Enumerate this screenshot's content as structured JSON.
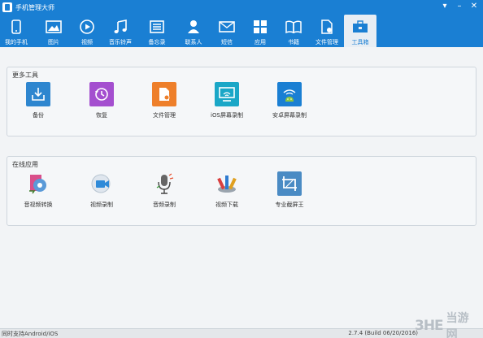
{
  "app": {
    "title": "手机管理大师"
  },
  "nav": [
    {
      "label": "我的手机",
      "icon": "phone-icon"
    },
    {
      "label": "图片",
      "icon": "image-icon"
    },
    {
      "label": "视频",
      "icon": "video-icon"
    },
    {
      "label": "音乐铃声",
      "icon": "music-icon"
    },
    {
      "label": "备忘录",
      "icon": "memo-icon"
    },
    {
      "label": "联系人",
      "icon": "contacts-icon"
    },
    {
      "label": "短信",
      "icon": "sms-icon"
    },
    {
      "label": "应用",
      "icon": "apps-icon"
    },
    {
      "label": "书籍",
      "icon": "book-icon"
    },
    {
      "label": "文件管理",
      "icon": "file-manager-icon"
    },
    {
      "label": "工具箱",
      "icon": "toolbox-icon",
      "active": true
    }
  ],
  "groups": {
    "more_tools": {
      "title": "更多工具",
      "tools": [
        {
          "label": "备份",
          "icon": "backup-icon",
          "color": "#2e86cf"
        },
        {
          "label": "恢复",
          "icon": "restore-icon",
          "color": "#a44fcf"
        },
        {
          "label": "文件管理",
          "icon": "file-manage-icon",
          "color": "#ee7f2a"
        },
        {
          "label": "iOS屏幕录制",
          "icon": "ios-screen-record-icon",
          "color": "#1aa7c7"
        },
        {
          "label": "安卓屏幕录制",
          "icon": "android-screen-record-icon",
          "color": "#1a7fd3"
        }
      ]
    },
    "online_apps": {
      "title": "在线应用",
      "tools": [
        {
          "label": "音视频转换",
          "icon": "av-convert-icon"
        },
        {
          "label": "视频录制",
          "icon": "video-record-icon"
        },
        {
          "label": "音频录制",
          "icon": "audio-record-icon"
        },
        {
          "label": "视频下载",
          "icon": "video-download-icon"
        },
        {
          "label": "专业截屏王",
          "icon": "screenshot-pro-icon"
        }
      ]
    }
  },
  "status": {
    "left": "同时支持Android/iOS",
    "right": "2.7.4 (Build 06/20/2016)"
  },
  "watermark": {
    "logo": "3HE",
    "text": "当游网"
  }
}
